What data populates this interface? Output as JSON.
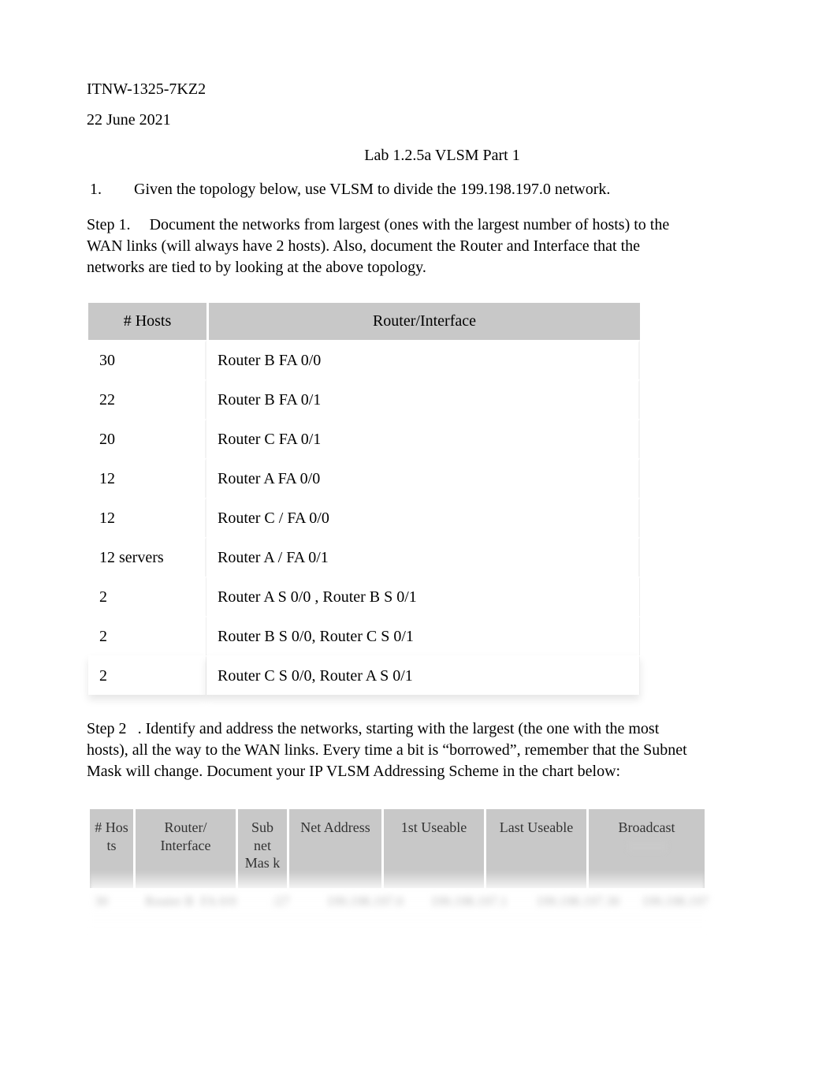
{
  "course_code": "ITNW-1325-7KZ2",
  "date": "22 June 2021",
  "title": "Lab 1.2.5a VLSM Part 1",
  "q1_number": "1.",
  "q1_text": "Given the topology below, use VLSM to divide the 199.198.197.0 network.",
  "step1_label": "Step 1.",
  "step1_text": "Document the networks from largest (ones with the largest number of hosts) to the WAN links (will always have 2 hosts). Also, document the Router and Interface that the networks are tied to by looking at the above topology.",
  "table1": {
    "headers": {
      "hosts": "# Hosts",
      "ri": "Router/Interface"
    },
    "rows": [
      {
        "hosts": "30",
        "ri": "Router B  FA 0/0"
      },
      {
        "hosts": "22",
        "ri": "Router B  FA 0/1"
      },
      {
        "hosts": "20",
        "ri": "Router C  FA 0/1"
      },
      {
        "hosts": "12",
        "ri": "Router A   FA 0/0"
      },
      {
        "hosts": "12",
        "ri": "Router C / FA 0/0"
      },
      {
        "hosts": "12 servers",
        "ri": "Router A / FA 0/1"
      },
      {
        "hosts": "2",
        "ri": "Router A S 0/0 , Router B S 0/1"
      },
      {
        "hosts": "2",
        "ri": "Router B S 0/0, Router C S 0/1"
      },
      {
        "hosts": "2",
        "ri": "Router C S 0/0, Router A S 0/1"
      }
    ]
  },
  "step2_label": "Step 2",
  "step2_text": ". Identify and address the networks, starting with the largest (the one with the most hosts), all the way to the WAN links. Every time a bit is “borrowed”, remember that the Subnet Mask will change. Document your IP VLSM Addressing Scheme in the chart below:",
  "table2": {
    "headers": {
      "hosts": "# Hos ts",
      "ri": "Router/ Interface",
      "mask": "Sub net Mas k",
      "net": "Net Address",
      "first": "1st Useable",
      "last": "Last Useable",
      "bcast": "Broadcast"
    }
  }
}
